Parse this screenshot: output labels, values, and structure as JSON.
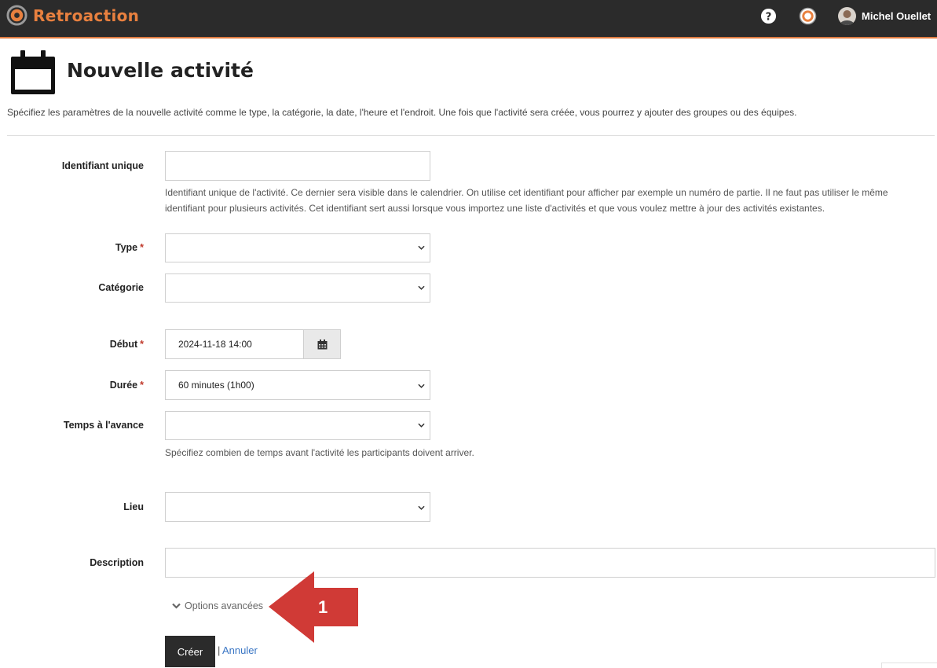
{
  "app": {
    "name": "Retroaction",
    "brand_color": "#e8803f",
    "bar_color": "#2b2b2b"
  },
  "user": {
    "name": "Michel Ouellet"
  },
  "header": {
    "title": "Nouvelle activité",
    "intro": "Spécifiez les paramètres de la nouvelle activité comme le type, la catégorie, la date, l'heure et l'endroit. Une fois que l'activité sera créée, vous pourrez y ajouter des groupes ou des équipes."
  },
  "form": {
    "identifier": {
      "label": "Identifiant unique",
      "value": "",
      "help_line1": "Identifiant unique de l'activité. Ce dernier sera visible dans le calendrier. On utilise cet identifiant pour afficher par exemple un numéro de partie. Il ne faut pas utiliser le même",
      "help_line2": "identifiant pour plusieurs activités. Cet identifiant sert aussi lorsque vous importez une liste d'activités et que vous voulez mettre à jour des activités existantes."
    },
    "type": {
      "label": "Type",
      "required_mark": "*",
      "value": ""
    },
    "category": {
      "label": "Catégorie",
      "value": ""
    },
    "start": {
      "label": "Début",
      "required_mark": "*",
      "value": "2024-11-18 14:00"
    },
    "duration": {
      "label": "Durée",
      "required_mark": "*",
      "value": "60 minutes (1h00)"
    },
    "advance_time": {
      "label": "Temps à l'avance",
      "value": "",
      "help": "Spécifiez combien de temps avant l'activité les participants doivent arriver."
    },
    "location": {
      "label": "Lieu",
      "value": ""
    },
    "description": {
      "label": "Description",
      "value": ""
    },
    "advanced_options_label": "Options avancées",
    "create_label": "Créer",
    "separator": "|",
    "cancel_label": "Annuler"
  },
  "annotation": {
    "number": "1",
    "color": "#d03a36"
  }
}
